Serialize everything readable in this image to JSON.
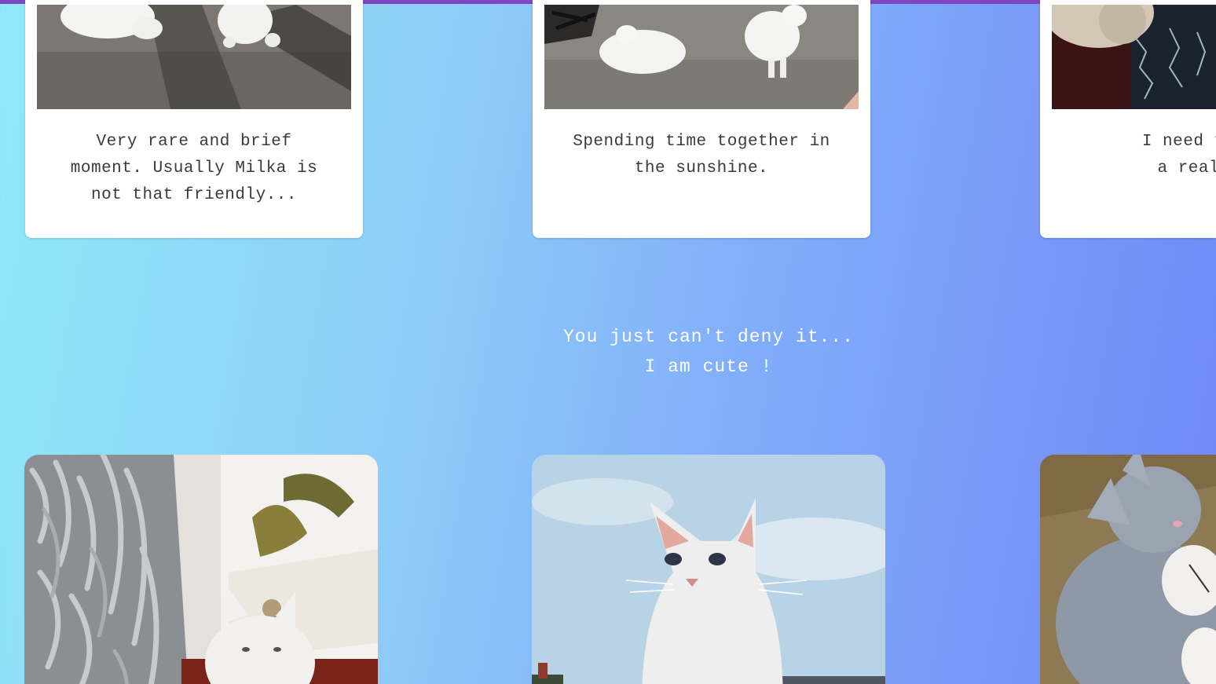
{
  "cards": [
    {
      "caption_lines": [
        "Very rare and brief",
        "moment. Usually Milka is",
        "not that friendly..."
      ],
      "photo_icon": "cats-on-pavement-photo"
    },
    {
      "caption_lines": [
        "Spending time together in",
        "the sunshine."
      ],
      "photo_icon": "cats-in-sunshine-photo"
    },
    {
      "caption_lines": [
        "I need to adm",
        "a really g"
      ],
      "photo_icon": "cat-on-lap-photo"
    }
  ],
  "quote": {
    "line1": "You just can't deny it...",
    "line2": "I am cute !"
  },
  "bottom_photos": [
    {
      "icon": "cat-on-fluffy-rug-photo"
    },
    {
      "icon": "cat-looking-down-sky-photo"
    },
    {
      "icon": "cat-with-plush-bunny-photo"
    }
  ],
  "colors": {
    "accent_bar": "#7e46c2",
    "card_bg": "#ffffff",
    "caption_text": "#3a3a3a",
    "quote_text": "#ffffff"
  }
}
